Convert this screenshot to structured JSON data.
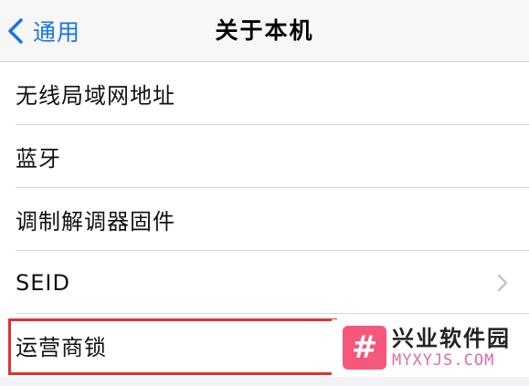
{
  "navbar": {
    "back_label": "通用",
    "title": "关于本机"
  },
  "rows": [
    {
      "label": "无线局域网地址",
      "has_chevron": false
    },
    {
      "label": "蓝牙",
      "has_chevron": false
    },
    {
      "label": "调制解调器固件",
      "has_chevron": false
    },
    {
      "label": "SEID",
      "has_chevron": true
    },
    {
      "label": "运营商锁",
      "has_chevron": false
    }
  ],
  "watermark": {
    "logo_glyph": "#",
    "name": "兴业软件园",
    "domain": "MYXYJS.COM"
  },
  "colors": {
    "accent": "#1a73e8",
    "highlight": "#e03131",
    "logo": "#f5587b"
  },
  "icons": {
    "back": "chevron-left-icon",
    "disclosure": "chevron-right-icon"
  }
}
